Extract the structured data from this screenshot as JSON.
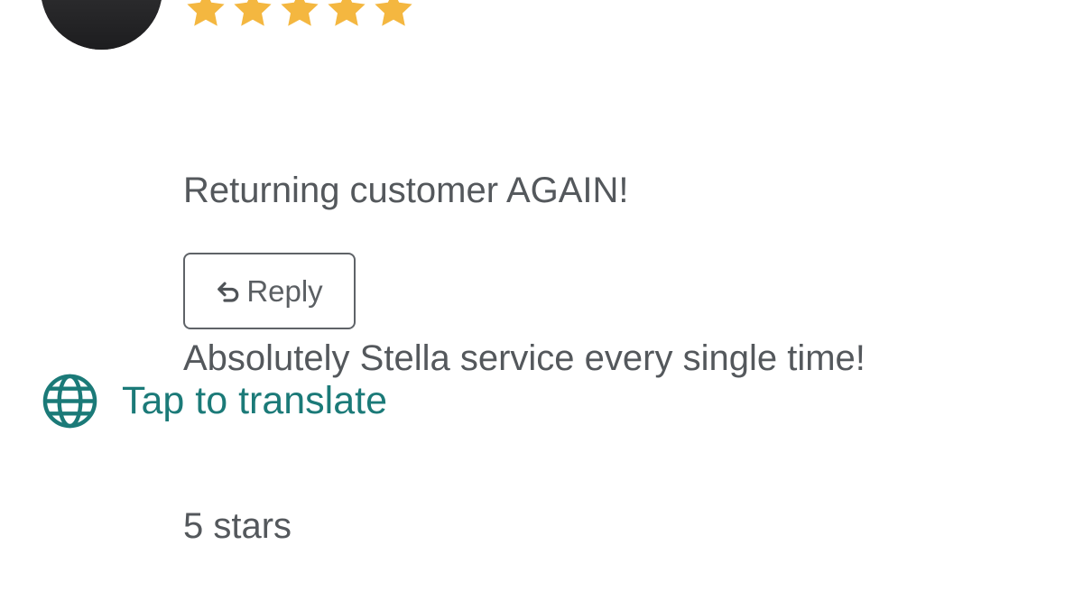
{
  "review": {
    "rating": 5,
    "rating_max": 5,
    "star_color": "#F4B740",
    "lines": [
      "Returning customer AGAIN!",
      "Absolutely Stella service every single time!",
      "5 stars"
    ]
  },
  "actions": {
    "reply_label": "Reply",
    "reply_icon": "reply-arrow-icon"
  },
  "translate": {
    "label": "Tap to translate",
    "icon": "globe-icon",
    "color": "#1B7A78"
  }
}
